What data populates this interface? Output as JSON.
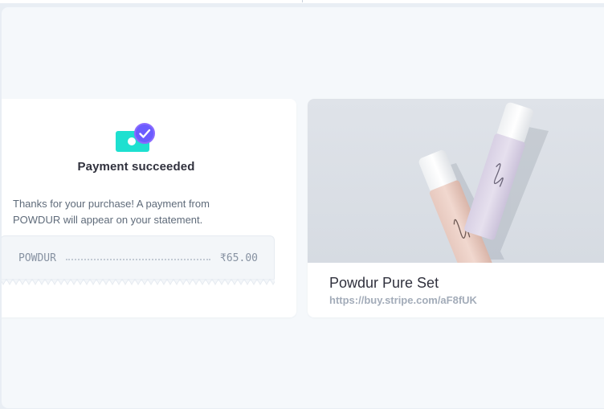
{
  "confirmation": {
    "title": "Payment succeeded",
    "message": "Thanks for your purchase! A payment from POWDUR will appear on your statement.",
    "receipt": {
      "merchant": "POWDUR",
      "amount": "₹65.00"
    }
  },
  "product": {
    "name": "Powdur Pure Set",
    "url": "https://buy.stripe.com/aF8fUK",
    "image_icon": "product-photo"
  },
  "colors": {
    "accent_teal": "#1ee0d0",
    "accent_purple": "#6b5cff",
    "text_primary": "#30313d",
    "text_secondary": "#5f6b7a",
    "text_muted": "#a3acb9"
  }
}
